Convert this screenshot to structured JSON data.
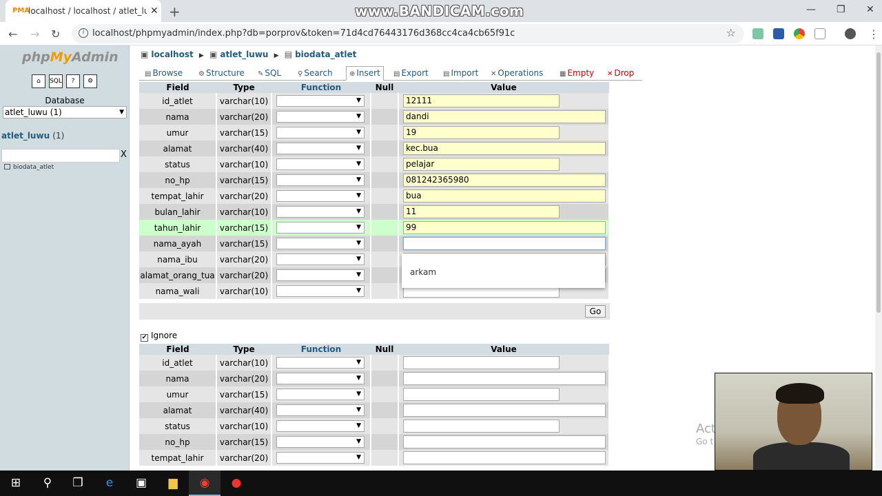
{
  "browser": {
    "tab_title": "localhost / localhost / atlet_luwu",
    "url": "localhost/phpmyadmin/index.php?db=porprov&token=71d4cd76443176d368cc4ca4cb65f91c",
    "watermark": "www.BANDICAM.com",
    "icons": [
      "back-arrow-icon",
      "forward-arrow-icon",
      "reload-icon",
      "info-icon",
      "star-icon",
      "profile-icon",
      "menu-icon"
    ]
  },
  "nav": {
    "logo": {
      "php": "php",
      "my": "My",
      "admin": "Admin"
    },
    "quick_icons": [
      "home-icon",
      "sql-icon",
      "docs-icon",
      "settings-icon"
    ],
    "database_label": "Database",
    "database_selected": "atlet_luwu (1)",
    "db_name": "atlet_luwu",
    "db_count": "(1)",
    "filter_clear": "X",
    "table_name": "biodata_atlet"
  },
  "breadcrumb": {
    "server": "localhost",
    "database": "atlet_luwu",
    "table": "biodata_atlet"
  },
  "tabs": [
    {
      "label": "Browse",
      "icon": "▤"
    },
    {
      "label": "Structure",
      "icon": "⚙"
    },
    {
      "label": "SQL",
      "icon": "✎"
    },
    {
      "label": "Search",
      "icon": "⚲"
    },
    {
      "label": "Insert",
      "icon": "⊕"
    },
    {
      "label": "Export",
      "icon": "▤"
    },
    {
      "label": "Import",
      "icon": "▤"
    },
    {
      "label": "Operations",
      "icon": "✕"
    },
    {
      "label": "Empty",
      "icon": "▦"
    },
    {
      "label": "Drop",
      "icon": "✕"
    }
  ],
  "columns": {
    "field": "Field",
    "type": "Type",
    "function": "Function",
    "null": "Null",
    "value": "Value"
  },
  "rows1": [
    {
      "field": "id_atlet",
      "type": "varchar(10)",
      "value": "12111"
    },
    {
      "field": "nama",
      "type": "varchar(20)",
      "value": "dandi"
    },
    {
      "field": "umur",
      "type": "varchar(15)",
      "value": "19"
    },
    {
      "field": "alamat",
      "type": "varchar(40)",
      "value": "kec.bua"
    },
    {
      "field": "status",
      "type": "varchar(10)",
      "value": "pelajar"
    },
    {
      "field": "no_hp",
      "type": "varchar(15)",
      "value": "081242365980"
    },
    {
      "field": "tempat_lahir",
      "type": "varchar(20)",
      "value": "bua"
    },
    {
      "field": "bulan_lahir",
      "type": "varchar(10)",
      "value": "11"
    },
    {
      "field": "tahun_lahir",
      "type": "varchar(15)",
      "value": "99"
    },
    {
      "field": "nama_ayah",
      "type": "varchar(15)",
      "value": ""
    },
    {
      "field": "nama_ibu",
      "type": "varchar(20)",
      "value": ""
    },
    {
      "field": "alamat_orang_tua",
      "type": "varchar(20)",
      "value": ""
    },
    {
      "field": "nama_wali",
      "type": "varchar(10)",
      "value": ""
    }
  ],
  "autocomplete_option": "arkam",
  "go_label": "Go",
  "ignore_label": "Ignore",
  "rows2": [
    {
      "field": "id_atlet",
      "type": "varchar(10)"
    },
    {
      "field": "nama",
      "type": "varchar(20)"
    },
    {
      "field": "umur",
      "type": "varchar(15)"
    },
    {
      "field": "alamat",
      "type": "varchar(40)"
    },
    {
      "field": "status",
      "type": "varchar(10)"
    },
    {
      "field": "no_hp",
      "type": "varchar(15)"
    },
    {
      "field": "tempat_lahir",
      "type": "varchar(20)"
    }
  ],
  "activate": {
    "line1": "Act",
    "line2": "Go t"
  },
  "taskbar": [
    "windows-start-icon",
    "search-icon",
    "task-view-icon",
    "edge-icon",
    "store-icon",
    "file-explorer-icon",
    "chrome-icon",
    "bandicam-record-icon"
  ]
}
